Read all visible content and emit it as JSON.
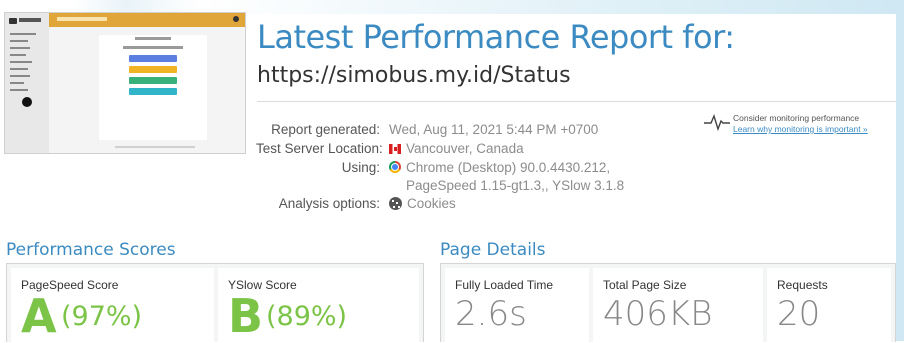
{
  "header": {
    "title": "Latest Performance Report for:",
    "url": "https://simobus.my.id/Status"
  },
  "thumbnail": {
    "app_title": "Status Monitoring Bus",
    "heading": "STATUS BUS",
    "subheading": "Bus Gedung Berhenti"
  },
  "info": {
    "report_generated_label": "Report generated:",
    "report_generated_value": "Wed, Aug 11, 2021 5:44 PM +0700",
    "location_label": "Test Server Location:",
    "location_value": "Vancouver, Canada",
    "using_label": "Using:",
    "using_value_line1": "Chrome (Desktop) 90.0.4430.212,",
    "using_value_line2": "PageSpeed 1.15-gt1.3,, YSlow 3.1.8",
    "options_label": "Analysis options:",
    "options_value": "Cookies"
  },
  "monitoring": {
    "text": "Consider monitoring performance",
    "link": "Learn why monitoring is important »"
  },
  "performance": {
    "title": "Performance Scores",
    "pagespeed_label": "PageSpeed Score",
    "pagespeed_grade": "A",
    "pagespeed_pct": "(97%)",
    "yslow_label": "YSlow Score",
    "yslow_grade": "B",
    "yslow_pct": "(89%)"
  },
  "details": {
    "title": "Page Details",
    "load_label": "Fully Loaded Time",
    "load_value": "2.6s",
    "size_label": "Total Page Size",
    "size_value": "406KB",
    "requests_label": "Requests",
    "requests_value": "20"
  },
  "colors": {
    "accent": "#3b8bc2",
    "grade_green": "#7cc448",
    "thumb_bar": "#e1a63a"
  }
}
